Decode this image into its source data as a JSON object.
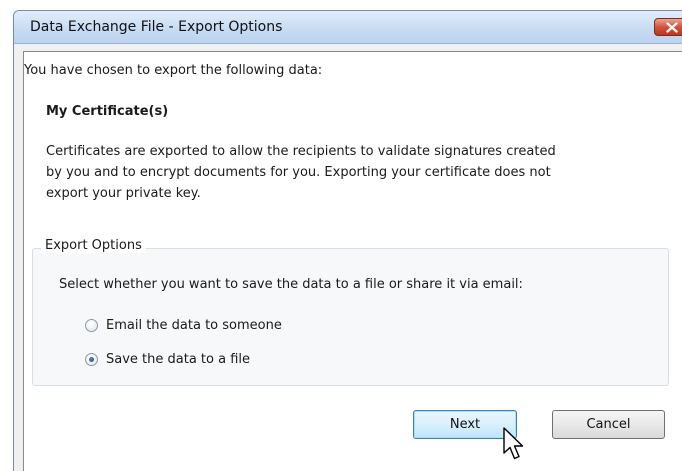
{
  "window": {
    "title": "Data Exchange File - Export Options"
  },
  "content": {
    "intro": "You have chosen to export the following data:",
    "data_type": "My Certificate(s)",
    "description_lines": [
      "Certificates are exported to allow the recipients to validate signatures created",
      "by you and to encrypt documents for you. Exporting your certificate does not",
      "export your private key."
    ]
  },
  "export_options": {
    "legend": "Export Options",
    "prompt": "Select whether you want to save the data to a file or share it via email:",
    "options": [
      {
        "label": "Email the data to someone",
        "checked": false
      },
      {
        "label": "Save the data to a file",
        "checked": true
      }
    ]
  },
  "buttons": {
    "next": "Next",
    "cancel": "Cancel"
  },
  "icons": {
    "close": "close-icon",
    "cursor": "mouse-pointer-icon"
  },
  "colors": {
    "close_button": "#c0341d",
    "title_bar": "#c8dcf3"
  }
}
